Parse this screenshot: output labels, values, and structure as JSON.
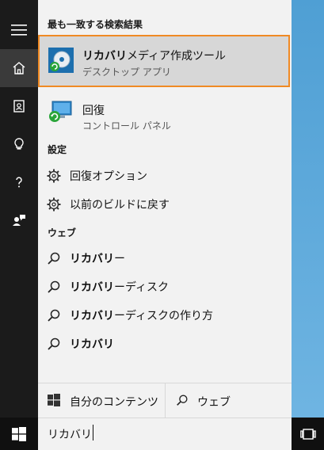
{
  "sections": {
    "best_match": "最も一致する検索結果",
    "settings": "設定",
    "web": "ウェブ"
  },
  "best_match": {
    "title_bold": "リカバリ",
    "title_rest": "メディア作成ツール",
    "subtitle": "デスクトップ アプリ"
  },
  "recovery": {
    "title": "回復",
    "subtitle": "コントロール パネル"
  },
  "settings_items": [
    {
      "label": "回復オプション"
    },
    {
      "label": "以前のビルドに戻す"
    }
  ],
  "web_items": [
    {
      "bold": "リカバリ",
      "rest": "ー"
    },
    {
      "bold": "リカバリ",
      "rest": "ーディスク"
    },
    {
      "bold": "リカバリ",
      "rest": "ーディスクの作り方"
    },
    {
      "bold": "リカバリ",
      "rest": ""
    }
  ],
  "tabs": {
    "my_content": "自分のコンテンツ",
    "web": "ウェブ"
  },
  "search": {
    "query": "リカバリ"
  },
  "colors": {
    "highlight_border": "#f08a24",
    "rail_bg": "#1b1b1b",
    "panel_bg": "#f2f2f2"
  }
}
